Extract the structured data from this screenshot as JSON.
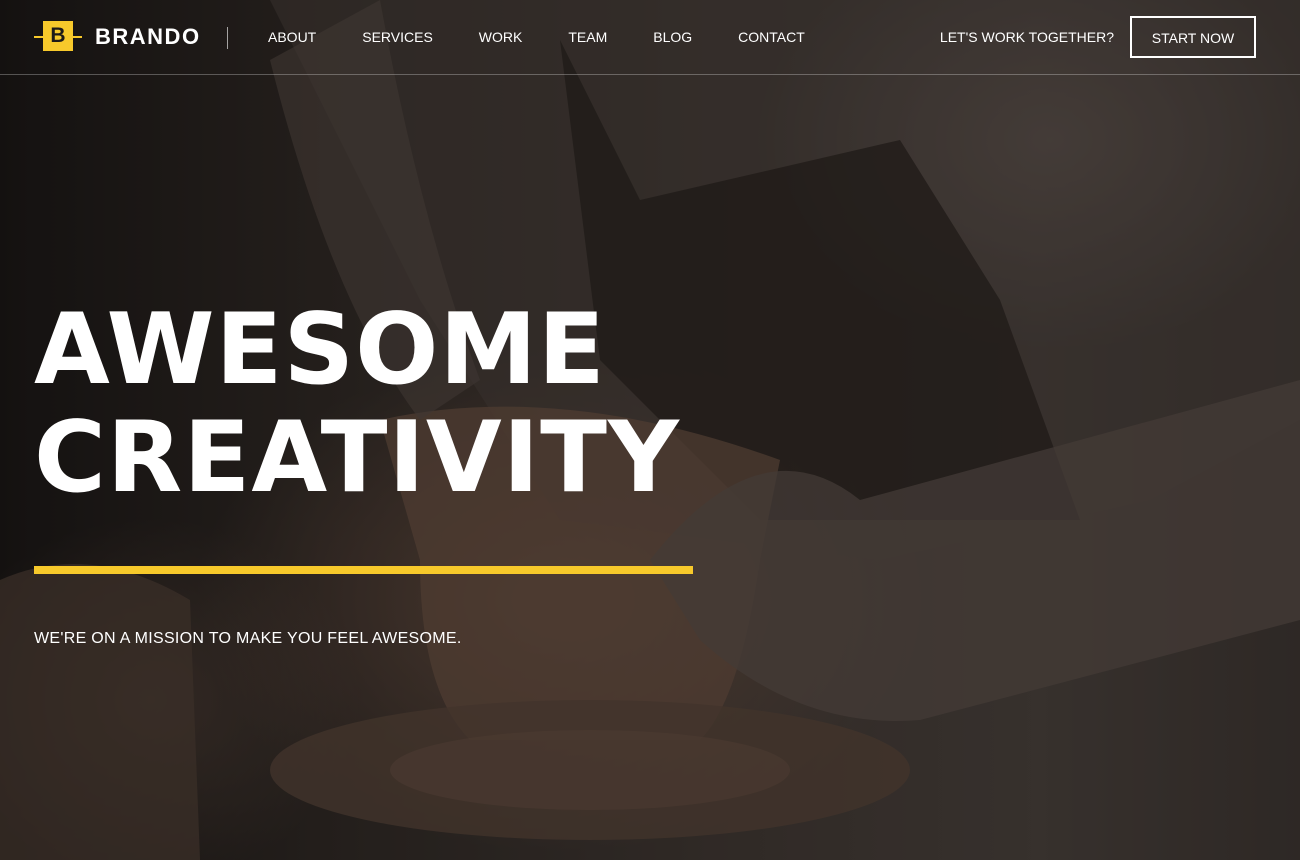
{
  "brand": {
    "logo_letter": "B",
    "name": "BRANDO"
  },
  "nav": {
    "items": [
      {
        "label": "ABOUT"
      },
      {
        "label": "SERVICES"
      },
      {
        "label": "WORK"
      },
      {
        "label": "TEAM"
      },
      {
        "label": "BLOG"
      },
      {
        "label": "CONTACT"
      }
    ]
  },
  "header": {
    "cta_text": "LET'S WORK TOGETHER?",
    "start_button_label": "START NOW"
  },
  "hero": {
    "title_line1": "AWESOME",
    "title_line2": "CREATIVITY",
    "tagline": "WE'RE ON A MISSION TO MAKE YOU FEEL AWESOME."
  },
  "colors": {
    "accent": "#f7c92b",
    "text": "#ffffff",
    "background": "#2b2522"
  }
}
